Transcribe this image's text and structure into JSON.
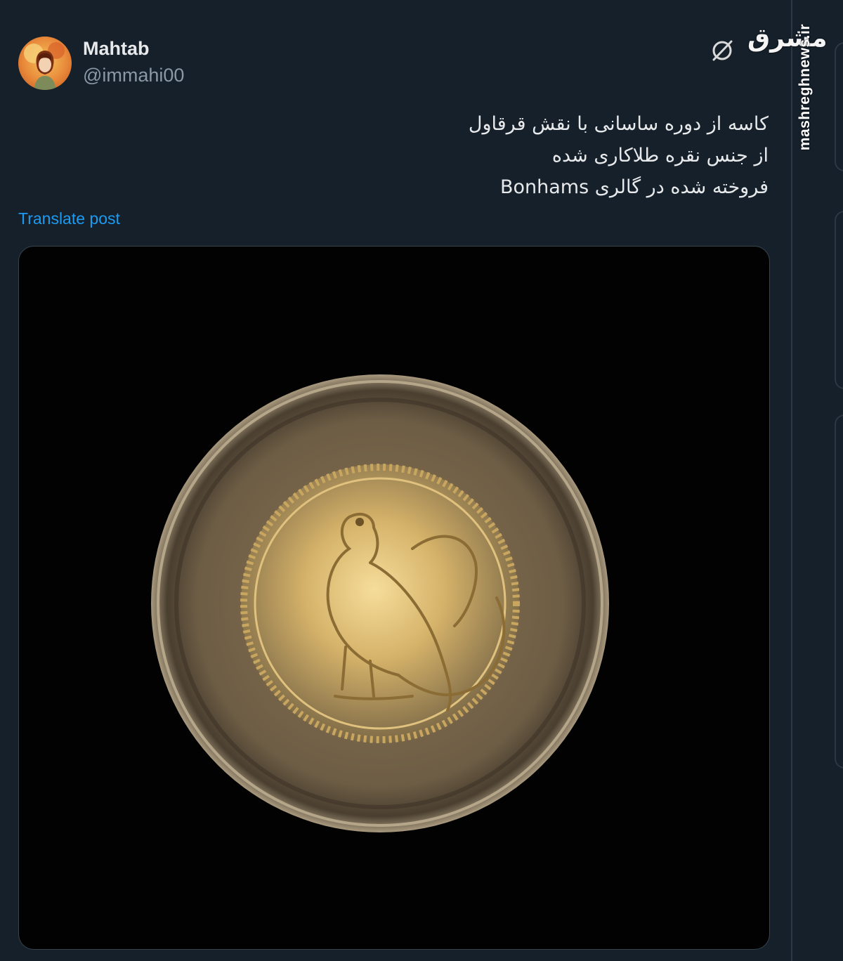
{
  "tweet": {
    "display_name": "Mahtab",
    "handle": "@immahi00",
    "lines": [
      "کاسه از دوره ساسانی با نقش قرقاول",
      "از جنس نقره طلاکاری شده",
      "فروخته شده در گالری Bonhams"
    ],
    "translate_label": "Translate post"
  },
  "watermark": {
    "logo_text": "مشرق",
    "url": "mashreghnews.ir"
  },
  "icons": {
    "avatar": "avatar-illustration",
    "grok": "grok-icon",
    "media": "bowl-photo"
  },
  "colors": {
    "background": "#15202b",
    "text": "#e7e9ea",
    "secondary_text": "#8b98a5",
    "link": "#1d9bf0"
  }
}
